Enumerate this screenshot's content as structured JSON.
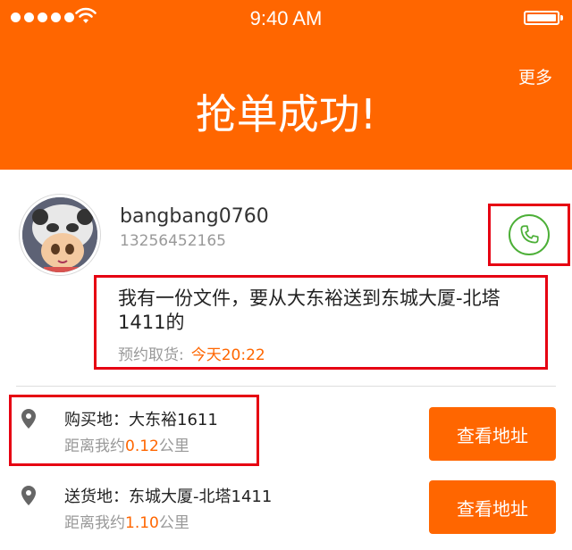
{
  "status_bar": {
    "time": "9:40 AM"
  },
  "header": {
    "more_label": "更多",
    "title": "抢单成功!"
  },
  "user": {
    "username": "bangbang0760",
    "phone": "13256452165"
  },
  "order": {
    "description": "我有一份文件，要从大东裕送到东城大厦-北塔1411的",
    "pickup_label": "预约取货:",
    "pickup_time": "今天20:22"
  },
  "addresses": [
    {
      "label": "购买地：大东裕1611",
      "distance_prefix": "距离我约",
      "distance_value": "0.12",
      "distance_unit": "公里",
      "button_label": "查看地址"
    },
    {
      "label": "送货地：东城大厦-北塔1411",
      "distance_prefix": "距离我约",
      "distance_value": "1.10",
      "distance_unit": "公里",
      "button_label": "查看地址"
    }
  ],
  "colors": {
    "brand": "#ff6600",
    "annotation": "#e60012",
    "call": "#4caf37"
  },
  "icons": {
    "call": "phone-icon",
    "location": "location-pin-icon",
    "avatar": "panda-hat-avatar"
  }
}
